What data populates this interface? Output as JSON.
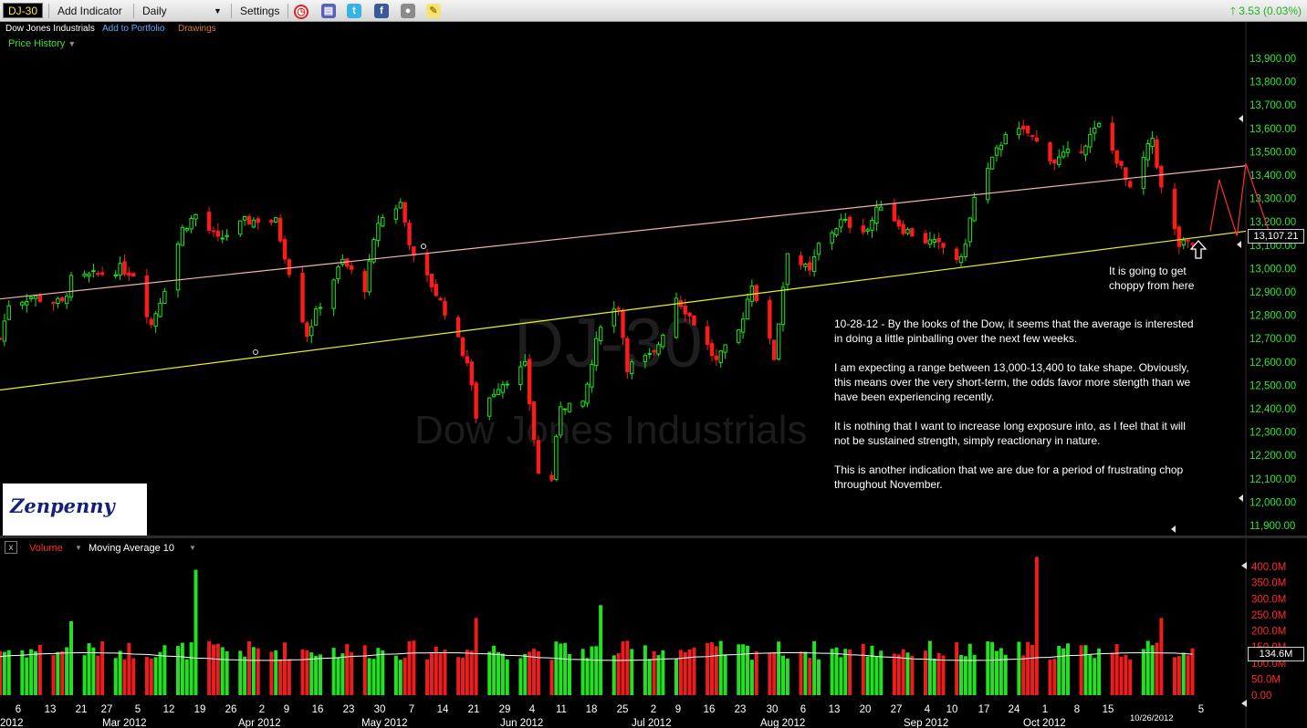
{
  "toolbar": {
    "symbol": "DJ-30",
    "add_indicator": "Add Indicator",
    "interval": "Daily",
    "settings": "Settings",
    "change": "3.53 (0.03%)"
  },
  "subbar": {
    "name": "Dow Jones Industrials",
    "add_portfolio": "Add to Portfolio",
    "drawings": "Drawings",
    "price_history": "Price History"
  },
  "watermark": {
    "symbol": "DJ-30",
    "name": "Dow Jones Industrials"
  },
  "logo": {
    "text": "Zenpenny"
  },
  "annotation": {
    "paragraphs": [
      "10-28-12 - By the looks of the Dow, it seems that the average is interested in doing a little pinballing over the next few weeks.",
      "I am expecting a range between 13,000-13,400 to take shape. Obviously, this means over the very short-term, the odds favor more stength than we have been experiencing recently.",
      "It is nothing that I want to increase long exposure into, as I feel that it will not be sustained strength, simply reactionary in nature.",
      "This is another indication that we are due for a period of frustrating chop throughout November."
    ],
    "callout": "It is going to get choppy from here"
  },
  "volume_panel": {
    "title": "Volume",
    "indicator": "Moving Average 10"
  },
  "colors": {
    "up": "#19e619",
    "down": "#ff1a1a",
    "axis_text": "#2ee82e",
    "vol_axis_text": "#ff2a2a",
    "upper_trend": "#f2b0b0",
    "lower_trend": "#f0f022",
    "projection": "#ff3030",
    "ma_line": "#ffffff"
  },
  "chart_data": [
    {
      "type": "candlestick",
      "ylim": [
        11850,
        13950
      ],
      "yticks": [
        11900,
        12000,
        12100,
        12200,
        12300,
        12400,
        12500,
        12600,
        12700,
        12800,
        12900,
        13000,
        13100,
        13200,
        13300,
        13400,
        13500,
        13600,
        13700,
        13800,
        13900
      ],
      "ytick_labels": [
        "11,900.00",
        "12,000.00",
        "12,100.00",
        "12,200.00",
        "12,300.00",
        "12,400.00",
        "12,500.00",
        "12,600.00",
        "12,700.00",
        "12,800.00",
        "12,900.00",
        "13,000.00",
        "13,100.00",
        "13,200.00",
        "13,300.00",
        "13,400.00",
        "13,500.00",
        "13,600.00",
        "13,700.00",
        "13,800.00",
        "13,900.00"
      ],
      "last_price_label": "13,107.21",
      "last_price": 13107.21,
      "x_date_range": [
        "2012-02-01",
        "2012-11-07"
      ],
      "close_series": [
        [
          "2012-02-01",
          12700
        ],
        [
          "2012-02-03",
          12850
        ],
        [
          "2012-02-08",
          12880
        ],
        [
          "2012-02-15",
          12850
        ],
        [
          "2012-02-17",
          12950
        ],
        [
          "2012-02-22",
          12970
        ],
        [
          "2012-02-28",
          13000
        ],
        [
          "2012-03-02",
          12980
        ],
        [
          "2012-03-06",
          12760
        ],
        [
          "2012-03-09",
          12920
        ],
        [
          "2012-03-13",
          13170
        ],
        [
          "2012-03-16",
          13230
        ],
        [
          "2012-03-21",
          13120
        ],
        [
          "2012-03-27",
          13200
        ],
        [
          "2012-03-30",
          13210
        ],
        [
          "2012-04-03",
          13200
        ],
        [
          "2012-04-05",
          13060
        ],
        [
          "2012-04-10",
          12720
        ],
        [
          "2012-04-13",
          12850
        ],
        [
          "2012-04-18",
          13030
        ],
        [
          "2012-04-23",
          12920
        ],
        [
          "2012-04-26",
          13200
        ],
        [
          "2012-05-01",
          13280
        ],
        [
          "2012-05-04",
          13040
        ],
        [
          "2012-05-08",
          12930
        ],
        [
          "2012-05-11",
          12820
        ],
        [
          "2012-05-16",
          12600
        ],
        [
          "2012-05-18",
          12370
        ],
        [
          "2012-05-23",
          12500
        ],
        [
          "2012-05-29",
          12580
        ],
        [
          "2012-06-01",
          12120
        ],
        [
          "2012-06-04",
          12100
        ],
        [
          "2012-06-06",
          12420
        ],
        [
          "2012-06-11",
          12410
        ],
        [
          "2012-06-15",
          12770
        ],
        [
          "2012-06-19",
          12840
        ],
        [
          "2012-06-21",
          12580
        ],
        [
          "2012-06-27",
          12630
        ],
        [
          "2012-07-02",
          12880
        ],
        [
          "2012-07-06",
          12770
        ],
        [
          "2012-07-11",
          12600
        ],
        [
          "2012-07-16",
          12730
        ],
        [
          "2012-07-19",
          12940
        ],
        [
          "2012-07-24",
          12620
        ],
        [
          "2012-07-27",
          13080
        ],
        [
          "2012-08-01",
          12980
        ],
        [
          "2012-08-03",
          13100
        ],
        [
          "2012-08-08",
          13200
        ],
        [
          "2012-08-14",
          13170
        ],
        [
          "2012-08-17",
          13280
        ],
        [
          "2012-08-22",
          13170
        ],
        [
          "2012-08-27",
          13120
        ],
        [
          "2012-08-31",
          13090
        ],
        [
          "2012-09-04",
          13030
        ],
        [
          "2012-09-07",
          13300
        ],
        [
          "2012-09-13",
          13540
        ],
        [
          "2012-09-14",
          13590
        ],
        [
          "2012-09-19",
          13580
        ],
        [
          "2012-09-25",
          13460
        ],
        [
          "2012-10-01",
          13520
        ],
        [
          "2012-10-05",
          13610
        ],
        [
          "2012-10-09",
          13470
        ],
        [
          "2012-10-12",
          13330
        ],
        [
          "2012-10-17",
          13560
        ],
        [
          "2012-10-19",
          13340
        ],
        [
          "2012-10-23",
          13100
        ],
        [
          "2012-10-26",
          13107
        ]
      ],
      "trendlines": [
        {
          "name": "upper",
          "from": [
            "2012-02-01",
            12870
          ],
          "to": [
            "2012-11-07",
            13440
          ]
        },
        {
          "name": "lower",
          "from": [
            "2012-02-01",
            12480
          ],
          "to": [
            "2012-11-07",
            13160
          ]
        }
      ],
      "projection": [
        [
          "2012-10-30",
          13160
        ],
        [
          "2012-11-01",
          13380
        ],
        [
          "2012-11-05",
          13140
        ],
        [
          "2012-11-07",
          13450
        ],
        [
          "2012-11-12",
          13170
        ]
      ]
    },
    {
      "type": "bar",
      "series": [
        {
          "name": "Volume",
          "units": "M"
        },
        {
          "name": "Moving Average 10"
        }
      ],
      "ylim": [
        0,
        440
      ],
      "yticks": [
        0,
        50,
        100,
        150,
        200,
        250,
        300,
        350,
        400
      ],
      "ytick_labels": [
        "0.00",
        "50.0M",
        "100.0M",
        "150.0M",
        "200.0M",
        "250.0M",
        "300.0M",
        "350.0M",
        "400.0M"
      ],
      "last_value_label": "134.6M",
      "spikes": [
        [
          "2012-03-16",
          390
        ],
        [
          "2012-09-21",
          430
        ],
        [
          "2012-10-19",
          240
        ],
        [
          "2012-06-15",
          280
        ],
        [
          "2012-02-17",
          230
        ],
        [
          "2012-05-18",
          240
        ]
      ]
    }
  ],
  "x_axis": {
    "day_labels": [
      "6",
      "13",
      "21",
      "27",
      "5",
      "12",
      "19",
      "26",
      "2",
      "9",
      "16",
      "23",
      "30",
      "7",
      "14",
      "21",
      "29",
      "4",
      "11",
      "18",
      "25",
      "2",
      "9",
      "16",
      "23",
      "30",
      "6",
      "13",
      "20",
      "27",
      "4",
      "10",
      "17",
      "24",
      "1",
      "8",
      "15",
      "5"
    ],
    "month_labels": [
      "2012",
      "Mar 2012",
      "Apr 2012",
      "May 2012",
      "Jun 2012",
      "Jul 2012",
      "Aug 2012",
      "Sep 2012",
      "Oct 2012"
    ],
    "current_date": "10/26/2012"
  }
}
